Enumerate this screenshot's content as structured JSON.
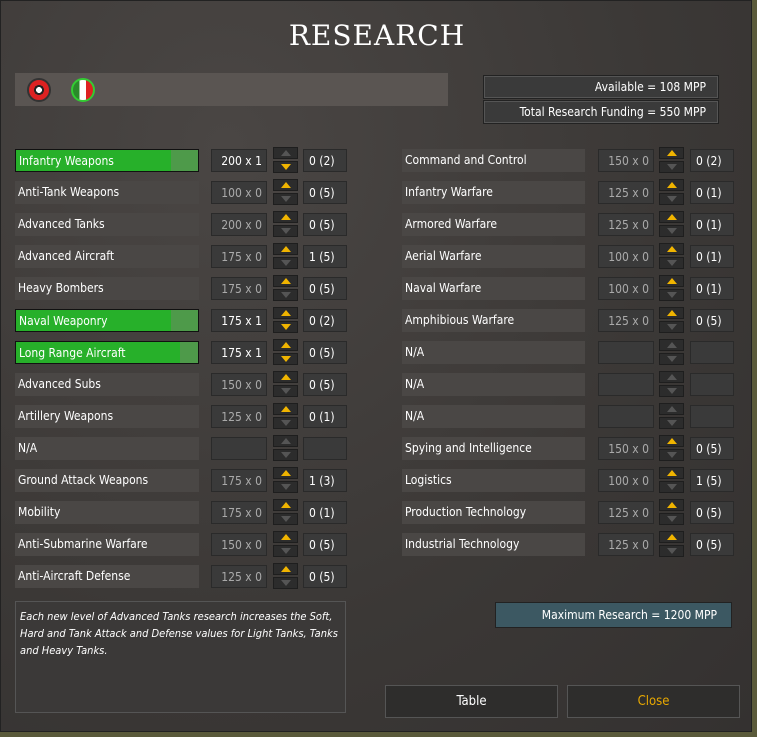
{
  "title": "RESEARCH",
  "flags": [
    "germany-flag",
    "italy-flag"
  ],
  "available": "Available =  108 MPP",
  "funding": "Total Research Funding =  550 MPP",
  "left": [
    {
      "name": "Infantry Weapons",
      "cost": "200 x 1",
      "level": "0 (2)",
      "active": true,
      "progress": 85,
      "up": false,
      "down": true
    },
    {
      "name": "Anti-Tank Weapons",
      "cost": "100 x 0",
      "level": "0 (5)",
      "up": true,
      "down": false
    },
    {
      "name": "Advanced Tanks",
      "cost": "200 x 0",
      "level": "0 (5)",
      "up": true,
      "down": false
    },
    {
      "name": "Advanced Aircraft",
      "cost": "175 x 0",
      "level": "1 (5)",
      "up": true,
      "down": false
    },
    {
      "name": "Heavy Bombers",
      "cost": "175 x 0",
      "level": "0 (5)",
      "up": true,
      "down": false
    },
    {
      "name": "Naval Weaponry",
      "cost": "175 x 1",
      "level": "0 (2)",
      "active": true,
      "progress": 85,
      "up": true,
      "down": true
    },
    {
      "name": "Long Range Aircraft",
      "cost": "175 x 1",
      "level": "0 (5)",
      "active": true,
      "progress": 90,
      "up": true,
      "down": true
    },
    {
      "name": "Advanced Subs",
      "cost": "150 x 0",
      "level": "0 (5)",
      "up": true,
      "down": false
    },
    {
      "name": "Artillery Weapons",
      "cost": "125 x 0",
      "level": "0 (1)",
      "up": true,
      "down": false
    },
    {
      "name": "N/A",
      "cost": "",
      "level": "",
      "up": false,
      "down": false
    },
    {
      "name": "Ground Attack Weapons",
      "cost": "175 x 0",
      "level": "1 (3)",
      "up": true,
      "down": false
    },
    {
      "name": "Mobility",
      "cost": "175 x 0",
      "level": "0 (1)",
      "up": true,
      "down": false
    },
    {
      "name": "Anti-Submarine Warfare",
      "cost": "150 x 0",
      "level": "0 (5)",
      "up": true,
      "down": false
    },
    {
      "name": "Anti-Aircraft Defense",
      "cost": "125 x 0",
      "level": "0 (5)",
      "up": true,
      "down": false
    }
  ],
  "right": [
    {
      "name": "Command and Control",
      "cost": "150 x 0",
      "level": "0 (2)",
      "up": true,
      "down": false
    },
    {
      "name": "Infantry Warfare",
      "cost": "125 x 0",
      "level": "0 (1)",
      "up": true,
      "down": false
    },
    {
      "name": "Armored Warfare",
      "cost": "125 x 0",
      "level": "0 (1)",
      "up": true,
      "down": false
    },
    {
      "name": "Aerial Warfare",
      "cost": "100 x 0",
      "level": "0 (1)",
      "up": true,
      "down": false
    },
    {
      "name": "Naval Warfare",
      "cost": "100 x 0",
      "level": "0 (1)",
      "up": true,
      "down": false
    },
    {
      "name": "Amphibious Warfare",
      "cost": "125 x 0",
      "level": "0 (5)",
      "up": true,
      "down": false
    },
    {
      "name": "N/A",
      "cost": "",
      "level": "",
      "up": false,
      "down": false
    },
    {
      "name": "N/A",
      "cost": "",
      "level": "",
      "up": false,
      "down": false
    },
    {
      "name": "N/A",
      "cost": "",
      "level": "",
      "up": false,
      "down": false
    },
    {
      "name": "Spying and Intelligence",
      "cost": "150 x 0",
      "level": "0 (5)",
      "up": true,
      "down": false
    },
    {
      "name": "Logistics",
      "cost": "100 x 0",
      "level": "1 (5)",
      "up": true,
      "down": false
    },
    {
      "name": "Production Technology",
      "cost": "125 x 0",
      "level": "0 (5)",
      "up": true,
      "down": false
    },
    {
      "name": "Industrial Technology",
      "cost": "125 x 0",
      "level": "0 (5)",
      "up": true,
      "down": false
    }
  ],
  "description": "Each new level of Advanced Tanks research increases the Soft, Hard and Tank Attack and Defense values for Light Tanks, Tanks and Heavy Tanks.",
  "max_research": "Maximum Research =   1200 MPP",
  "buttons": {
    "table": "Table",
    "close": "Close"
  }
}
